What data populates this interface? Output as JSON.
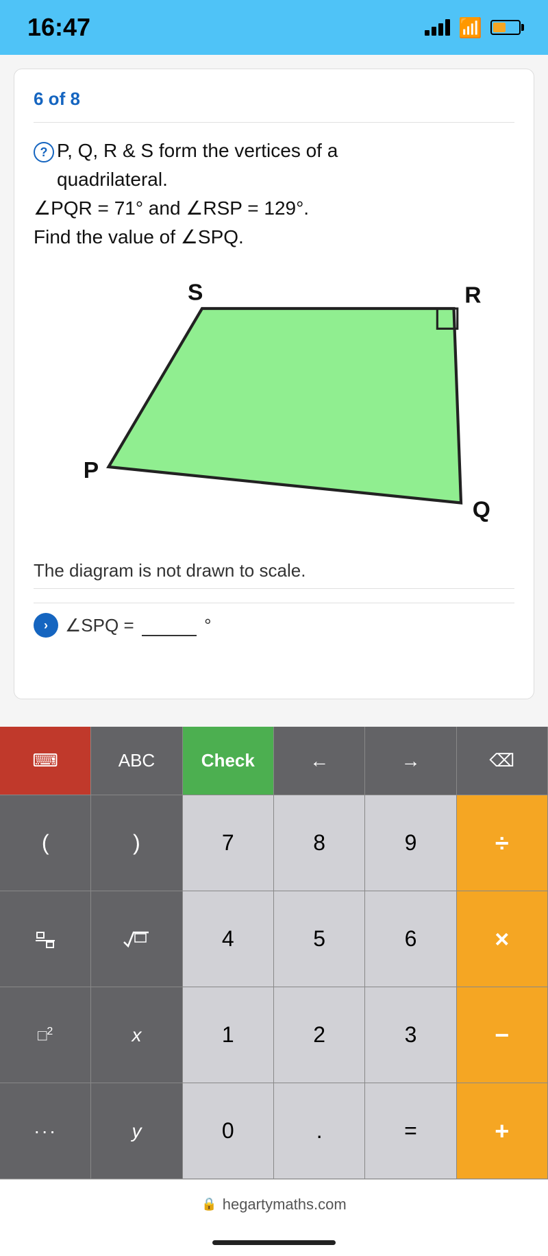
{
  "statusBar": {
    "time": "16:47",
    "domain": "hegartymaths.com"
  },
  "progress": {
    "label": "6 of 8"
  },
  "question": {
    "icon": "?",
    "text_line1": "P, Q, R & S form the vertices of a",
    "text_line2": "quadrilateral.",
    "text_line3": "∠PQR = 71° and ∠RSP = 129°.",
    "text_line4": "Find the value of ∠SPQ.",
    "diagram_note": "The diagram is not drawn to scale.",
    "answer_prefix": "∠SPQ =",
    "answer_suffix": "°",
    "vertices": {
      "S": "S",
      "R": "R",
      "P": "P",
      "Q": "Q"
    }
  },
  "keyboard": {
    "top_row": {
      "keyboard_icon": "⌨",
      "abc_label": "ABC",
      "check_label": "Check",
      "left_arrow": "←",
      "right_arrow": "→",
      "backspace": "⌫"
    },
    "rows": [
      {
        "keys": [
          {
            "label": "(",
            "type": "dark"
          },
          {
            "label": ")",
            "type": "dark"
          },
          {
            "label": "7",
            "type": "light"
          },
          {
            "label": "8",
            "type": "light"
          },
          {
            "label": "9",
            "type": "light"
          },
          {
            "label": "÷",
            "type": "orange"
          }
        ]
      },
      {
        "keys": [
          {
            "label": "□/□",
            "type": "fraction"
          },
          {
            "label": "√□",
            "type": "sqrt"
          },
          {
            "label": "4",
            "type": "light"
          },
          {
            "label": "5",
            "type": "light"
          },
          {
            "label": "6",
            "type": "light"
          },
          {
            "label": "×",
            "type": "orange"
          }
        ]
      },
      {
        "keys": [
          {
            "label": "□²",
            "type": "power"
          },
          {
            "label": "x",
            "type": "dark"
          },
          {
            "label": "1",
            "type": "light"
          },
          {
            "label": "2",
            "type": "light"
          },
          {
            "label": "3",
            "type": "light"
          },
          {
            "label": "−",
            "type": "orange"
          }
        ]
      },
      {
        "keys": [
          {
            "label": "...",
            "type": "dots"
          },
          {
            "label": "y",
            "type": "dark"
          },
          {
            "label": "0",
            "type": "light"
          },
          {
            "label": ".",
            "type": "light"
          },
          {
            "label": "=",
            "type": "light"
          },
          {
            "label": "+",
            "type": "orange"
          }
        ]
      }
    ]
  }
}
